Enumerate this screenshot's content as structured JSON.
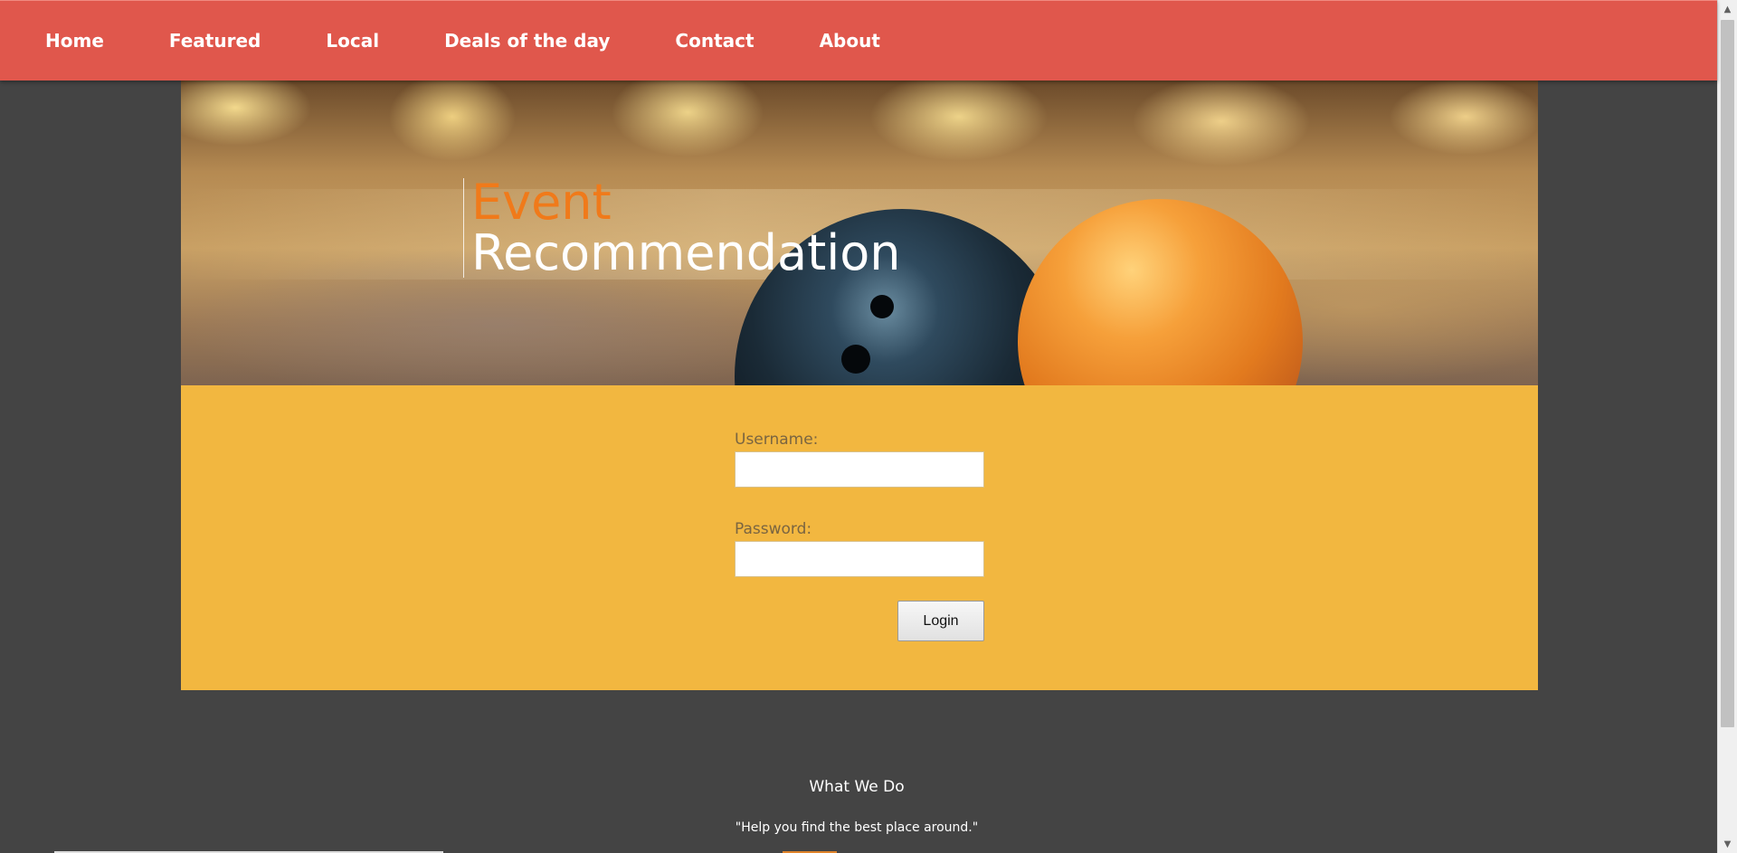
{
  "nav": {
    "items": [
      {
        "label": "Home"
      },
      {
        "label": "Featured"
      },
      {
        "label": "Local"
      },
      {
        "label": "Deals of the day"
      },
      {
        "label": "Contact"
      },
      {
        "label": "About"
      }
    ]
  },
  "hero": {
    "title_line1": "Event",
    "title_line2": "Recommendation"
  },
  "login": {
    "username_label": "Username:",
    "username_value": "",
    "password_label": "Password:",
    "password_value": "",
    "login_button": "Login"
  },
  "footer": {
    "heading": "What We Do",
    "tagline": "\"Help you find the best place around.\""
  },
  "colors": {
    "nav_bg": "#e0574c",
    "page_bg": "#444444",
    "login_panel_bg": "#f2b740",
    "hero_accent": "#f07a1a"
  }
}
